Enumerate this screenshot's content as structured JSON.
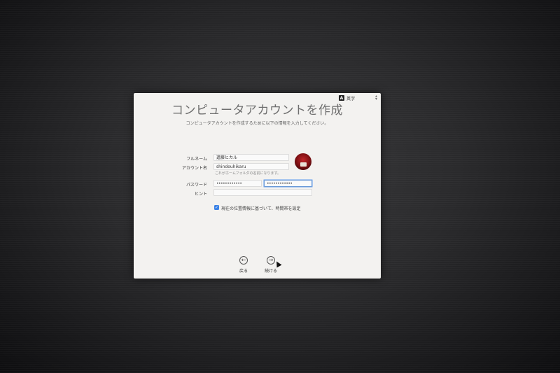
{
  "window": {
    "title": "コンピュータアカウントを作成",
    "subtitle": "コンピュータアカウントを作成するために以下の情報を入力してください。"
  },
  "input_method": {
    "badge": "A",
    "label": "英字"
  },
  "form": {
    "full_name": {
      "label": "フルネーム",
      "value": "進藤ヒカル"
    },
    "account_name": {
      "label": "アカウント名",
      "value": "shindouhikaru",
      "hint": "これがホームフォルダの名前になります。"
    },
    "password": {
      "label": "パスワード",
      "value": "••••••••••••",
      "verify_value": "••••••••••••"
    },
    "hint": {
      "label": "ヒント",
      "placeholder": ""
    }
  },
  "location_option": {
    "checked": true,
    "label": "現在の位置情報に基づいて、時間帯を設定"
  },
  "navigation": {
    "back_label": "戻る",
    "continue_label": "続ける"
  },
  "icons": {
    "back": "arrow-left-icon",
    "continue": "arrow-right-icon",
    "check": "checkmark-icon"
  },
  "colors": {
    "accent": "#3b82e6",
    "focus_ring": "#6a9ad8",
    "avatar": "#c0262a"
  }
}
